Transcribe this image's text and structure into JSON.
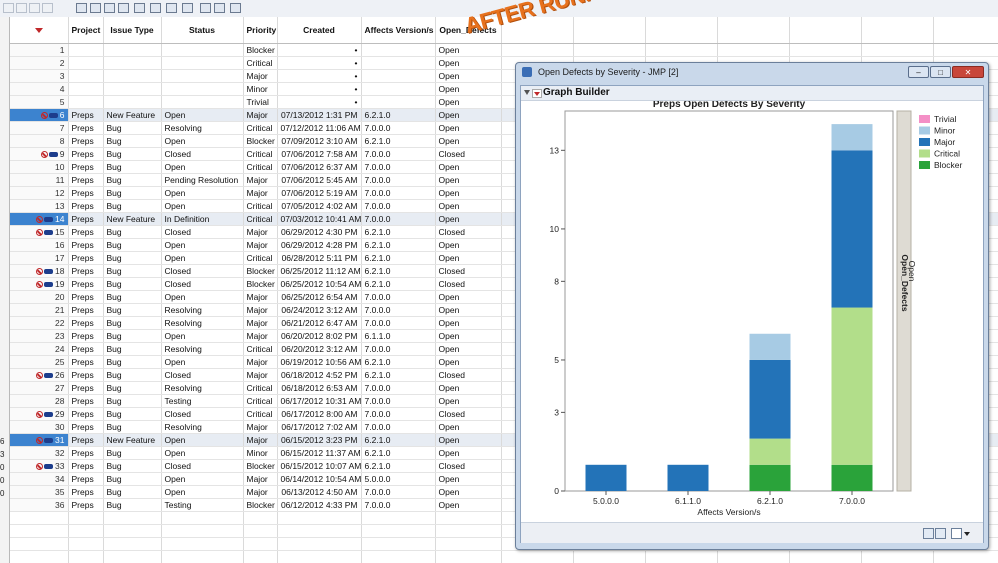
{
  "overlay_text": "AFTER RUNNING THE SCRIPT",
  "window": {
    "title": "Open Defects by Severity - JMP [2]",
    "minimize": "–",
    "maximize": "□",
    "close": "✕"
  },
  "graph_builder": {
    "label": "Graph Builder"
  },
  "left_panel_numbers": [
    "6",
    "3",
    "0",
    "0",
    "0"
  ],
  "table": {
    "columns": [
      "Project",
      "Issue Type",
      "Status",
      "Priority",
      "Created",
      "Affects Version/s",
      "Open_Defects"
    ],
    "rows": [
      {
        "n": "1",
        "project": "",
        "type": "",
        "status": "",
        "priority": "Blocker",
        "created": "•",
        "version": "",
        "open": "Open",
        "sel": false,
        "icons": false
      },
      {
        "n": "2",
        "project": "",
        "type": "",
        "status": "",
        "priority": "Critical",
        "created": "•",
        "version": "",
        "open": "Open",
        "sel": false,
        "icons": false
      },
      {
        "n": "3",
        "project": "",
        "type": "",
        "status": "",
        "priority": "Major",
        "created": "•",
        "version": "",
        "open": "Open",
        "sel": false,
        "icons": false
      },
      {
        "n": "4",
        "project": "",
        "type": "",
        "status": "",
        "priority": "Minor",
        "created": "•",
        "version": "",
        "open": "Open",
        "sel": false,
        "icons": false
      },
      {
        "n": "5",
        "project": "",
        "type": "",
        "status": "",
        "priority": "Trivial",
        "created": "•",
        "version": "",
        "open": "Open",
        "sel": false,
        "icons": false
      },
      {
        "n": "6",
        "project": "Preps",
        "type": "New Feature",
        "status": "Open",
        "priority": "Major",
        "created": "07/13/2012 1:31 PM",
        "version": "6.2.1.0",
        "open": "Open",
        "sel": true,
        "icons": true
      },
      {
        "n": "7",
        "project": "Preps",
        "type": "Bug",
        "status": "Resolving",
        "priority": "Critical",
        "created": "07/12/2012 11:06 AM",
        "version": "7.0.0.0",
        "open": "Open",
        "sel": false,
        "icons": false
      },
      {
        "n": "8",
        "project": "Preps",
        "type": "Bug",
        "status": "Open",
        "priority": "Blocker",
        "created": "07/09/2012 3:10 AM",
        "version": "6.2.1.0",
        "open": "Open",
        "sel": false,
        "icons": false
      },
      {
        "n": "9",
        "project": "Preps",
        "type": "Bug",
        "status": "Closed",
        "priority": "Critical",
        "created": "07/06/2012 7:58 AM",
        "version": "7.0.0.0",
        "open": "Closed",
        "sel": false,
        "icons": true
      },
      {
        "n": "10",
        "project": "Preps",
        "type": "Bug",
        "status": "Open",
        "priority": "Critical",
        "created": "07/06/2012 6:37 AM",
        "version": "7.0.0.0",
        "open": "Open",
        "sel": false,
        "icons": false
      },
      {
        "n": "11",
        "project": "Preps",
        "type": "Bug",
        "status": "Pending Resolution",
        "priority": "Major",
        "created": "07/06/2012 5:45 AM",
        "version": "7.0.0.0",
        "open": "Open",
        "sel": false,
        "icons": false
      },
      {
        "n": "12",
        "project": "Preps",
        "type": "Bug",
        "status": "Open",
        "priority": "Major",
        "created": "07/06/2012 5:19 AM",
        "version": "7.0.0.0",
        "open": "Open",
        "sel": false,
        "icons": false
      },
      {
        "n": "13",
        "project": "Preps",
        "type": "Bug",
        "status": "Open",
        "priority": "Critical",
        "created": "07/05/2012 4:02 AM",
        "version": "7.0.0.0",
        "open": "Open",
        "sel": false,
        "icons": false
      },
      {
        "n": "14",
        "project": "Preps",
        "type": "New Feature",
        "status": "In Definition",
        "priority": "Critical",
        "created": "07/03/2012 10:41 AM",
        "version": "7.0.0.0",
        "open": "Open",
        "sel": true,
        "icons": true
      },
      {
        "n": "15",
        "project": "Preps",
        "type": "Bug",
        "status": "Closed",
        "priority": "Major",
        "created": "06/29/2012 4:30 PM",
        "version": "6.2.1.0",
        "open": "Closed",
        "sel": false,
        "icons": true
      },
      {
        "n": "16",
        "project": "Preps",
        "type": "Bug",
        "status": "Open",
        "priority": "Major",
        "created": "06/29/2012 4:28 PM",
        "version": "6.2.1.0",
        "open": "Open",
        "sel": false,
        "icons": false
      },
      {
        "n": "17",
        "project": "Preps",
        "type": "Bug",
        "status": "Open",
        "priority": "Critical",
        "created": "06/28/2012 5:11 PM",
        "version": "6.2.1.0",
        "open": "Open",
        "sel": false,
        "icons": false
      },
      {
        "n": "18",
        "project": "Preps",
        "type": "Bug",
        "status": "Closed",
        "priority": "Blocker",
        "created": "06/25/2012 11:12 AM",
        "version": "6.2.1.0",
        "open": "Closed",
        "sel": false,
        "icons": true
      },
      {
        "n": "19",
        "project": "Preps",
        "type": "Bug",
        "status": "Closed",
        "priority": "Blocker",
        "created": "06/25/2012 10:54 AM",
        "version": "6.2.1.0",
        "open": "Closed",
        "sel": false,
        "icons": true
      },
      {
        "n": "20",
        "project": "Preps",
        "type": "Bug",
        "status": "Open",
        "priority": "Major",
        "created": "06/25/2012 6:54 AM",
        "version": "7.0.0.0",
        "open": "Open",
        "sel": false,
        "icons": false
      },
      {
        "n": "21",
        "project": "Preps",
        "type": "Bug",
        "status": "Resolving",
        "priority": "Major",
        "created": "06/24/2012 3:12 AM",
        "version": "7.0.0.0",
        "open": "Open",
        "sel": false,
        "icons": false
      },
      {
        "n": "22",
        "project": "Preps",
        "type": "Bug",
        "status": "Resolving",
        "priority": "Major",
        "created": "06/21/2012 6:47 AM",
        "version": "7.0.0.0",
        "open": "Open",
        "sel": false,
        "icons": false
      },
      {
        "n": "23",
        "project": "Preps",
        "type": "Bug",
        "status": "Open",
        "priority": "Major",
        "created": "06/20/2012 8:02 PM",
        "version": "6.1.1.0",
        "open": "Open",
        "sel": false,
        "icons": false
      },
      {
        "n": "24",
        "project": "Preps",
        "type": "Bug",
        "status": "Resolving",
        "priority": "Critical",
        "created": "06/20/2012 3:12 AM",
        "version": "7.0.0.0",
        "open": "Open",
        "sel": false,
        "icons": false
      },
      {
        "n": "25",
        "project": "Preps",
        "type": "Bug",
        "status": "Open",
        "priority": "Major",
        "created": "06/19/2012 10:56 AM",
        "version": "6.2.1.0",
        "open": "Open",
        "sel": false,
        "icons": false
      },
      {
        "n": "26",
        "project": "Preps",
        "type": "Bug",
        "status": "Closed",
        "priority": "Major",
        "created": "06/18/2012 4:52 PM",
        "version": "6.2.1.0",
        "open": "Closed",
        "sel": false,
        "icons": true
      },
      {
        "n": "27",
        "project": "Preps",
        "type": "Bug",
        "status": "Resolving",
        "priority": "Critical",
        "created": "06/18/2012 6:53 AM",
        "version": "7.0.0.0",
        "open": "Open",
        "sel": false,
        "icons": false
      },
      {
        "n": "28",
        "project": "Preps",
        "type": "Bug",
        "status": "Testing",
        "priority": "Critical",
        "created": "06/17/2012 10:31 AM",
        "version": "7.0.0.0",
        "open": "Open",
        "sel": false,
        "icons": false
      },
      {
        "n": "29",
        "project": "Preps",
        "type": "Bug",
        "status": "Closed",
        "priority": "Critical",
        "created": "06/17/2012 8:00 AM",
        "version": "7.0.0.0",
        "open": "Closed",
        "sel": false,
        "icons": true
      },
      {
        "n": "30",
        "project": "Preps",
        "type": "Bug",
        "status": "Resolving",
        "priority": "Major",
        "created": "06/17/2012 7:02 AM",
        "version": "7.0.0.0",
        "open": "Open",
        "sel": false,
        "icons": false
      },
      {
        "n": "31",
        "project": "Preps",
        "type": "New Feature",
        "status": "Open",
        "priority": "Major",
        "created": "06/15/2012 3:23 PM",
        "version": "6.2.1.0",
        "open": "Open",
        "sel": true,
        "icons": true
      },
      {
        "n": "32",
        "project": "Preps",
        "type": "Bug",
        "status": "Open",
        "priority": "Minor",
        "created": "06/15/2012 11:37 AM",
        "version": "6.2.1.0",
        "open": "Open",
        "sel": false,
        "icons": false
      },
      {
        "n": "33",
        "project": "Preps",
        "type": "Bug",
        "status": "Closed",
        "priority": "Blocker",
        "created": "06/15/2012 10:07 AM",
        "version": "6.2.1.0",
        "open": "Closed",
        "sel": false,
        "icons": true
      },
      {
        "n": "34",
        "project": "Preps",
        "type": "Bug",
        "status": "Open",
        "priority": "Major",
        "created": "06/14/2012 10:54 AM",
        "version": "5.0.0.0",
        "open": "Open",
        "sel": false,
        "icons": false
      },
      {
        "n": "35",
        "project": "Preps",
        "type": "Bug",
        "status": "Open",
        "priority": "Major",
        "created": "06/13/2012 4:50 AM",
        "version": "7.0.0.0",
        "open": "Open",
        "sel": false,
        "icons": false
      },
      {
        "n": "36",
        "project": "Preps",
        "type": "Bug",
        "status": "Testing",
        "priority": "Blocker",
        "created": "06/12/2012 4:33 PM",
        "version": "7.0.0.0",
        "open": "Open",
        "sel": false,
        "icons": false
      }
    ]
  },
  "colors": {
    "trivial": "#f48fc6",
    "minor": "#a7cbe4",
    "major": "#2373b8",
    "critical": "#b2de8a",
    "blocker": "#2aa33a",
    "selected_row": "#3c83cf",
    "overlay": "#e7711d"
  },
  "chart_data": {
    "type": "bar",
    "stacked": true,
    "title": "Preps   Open Defects By Severity",
    "xlabel": "Affects Version/s",
    "ylabel": "",
    "categories": [
      "5.0.0.0",
      "6.1.1.0",
      "6.2.1.0",
      "7.0.0.0"
    ],
    "series": [
      {
        "name": "Blocker",
        "values": [
          0,
          0,
          1,
          1
        ]
      },
      {
        "name": "Critical",
        "values": [
          0,
          0,
          1,
          6
        ]
      },
      {
        "name": "Major",
        "values": [
          1,
          1,
          3,
          6
        ]
      },
      {
        "name": "Minor",
        "values": [
          0,
          0,
          1,
          1
        ]
      },
      {
        "name": "Trivial",
        "values": [
          0,
          0,
          0,
          0
        ]
      }
    ],
    "legend": [
      "Trivial",
      "Minor",
      "Major",
      "Critical",
      "Blocker"
    ],
    "yticks": [
      "0",
      "3",
      "5",
      "8",
      "10",
      "13"
    ],
    "ylim": [
      0,
      14.5
    ],
    "legend_position": "right",
    "grid": false,
    "facet_title": "Open_Defects",
    "facet_value": "Open"
  }
}
